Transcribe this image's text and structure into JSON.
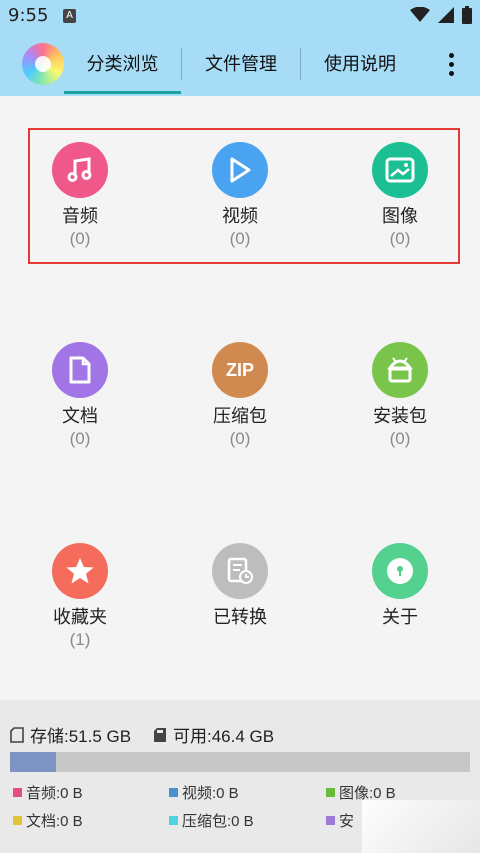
{
  "status_bar": {
    "time": "9:55",
    "sim_label": "A"
  },
  "tabs": [
    {
      "label": "分类浏览",
      "active": true
    },
    {
      "label": "文件管理",
      "active": false
    },
    {
      "label": "使用说明",
      "active": false
    }
  ],
  "categories": [
    {
      "label": "音频",
      "count": "(0)",
      "icon": "music-note-icon",
      "color": "#f0588a"
    },
    {
      "label": "视频",
      "count": "(0)",
      "icon": "play-icon",
      "color": "#4aa3f0"
    },
    {
      "label": "图像",
      "count": "(0)",
      "icon": "image-icon",
      "color": "#1cbf94"
    },
    {
      "label": "文档",
      "count": "(0)",
      "icon": "document-icon",
      "color": "#a275e6"
    },
    {
      "label": "压缩包",
      "count": "(0)",
      "icon": "zip-icon",
      "color": "#d08a4f",
      "icon_text": "ZIP"
    },
    {
      "label": "安装包",
      "count": "(0)",
      "icon": "android-icon",
      "color": "#79c54c"
    },
    {
      "label": "收藏夹",
      "count": "(1)",
      "icon": "star-icon",
      "color": "#f56c5d"
    },
    {
      "label": "已转换",
      "count": "",
      "icon": "converted-doc-icon",
      "color": "#bdbdbd"
    },
    {
      "label": "关于",
      "count": "",
      "icon": "about-icon",
      "color": "#55d18f"
    }
  ],
  "storage": {
    "total_label": "存储:51.5 GB",
    "free_label": "可用:46.4 GB",
    "used_fraction": 0.099
  },
  "legend": [
    {
      "label": "音频:0 B",
      "color": "#e3507d"
    },
    {
      "label": "视频:0 B",
      "color": "#4a8fd0"
    },
    {
      "label": "图像:0 B",
      "color": "#6cba3a"
    },
    {
      "label": "文档:0 B",
      "color": "#e0c53a"
    },
    {
      "label": "压缩包:0 B",
      "color": "#4fd3e0"
    },
    {
      "label": "安",
      "color": "#a07ad8"
    }
  ]
}
